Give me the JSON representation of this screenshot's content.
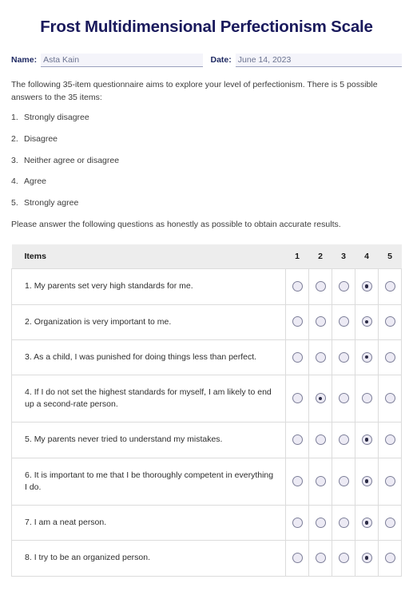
{
  "document": {
    "title": "Frost Multidimensional Perfectionism Scale"
  },
  "meta": {
    "name_label": "Name:",
    "name_value": "Asta Kain",
    "name_placeholder": "Name",
    "date_label": "Date:",
    "date_value": "June 14, 2023",
    "date_placeholder": "Date"
  },
  "intro": {
    "paragraph": "The following 35-item questionnaire aims to explore your level of perfectionism. There is 5 possible answers to the 35 items:",
    "closing": "Please answer the following questions as honestly as possible to obtain accurate results."
  },
  "options": [
    {
      "num": "1.",
      "label": "Strongly disagree"
    },
    {
      "num": "2.",
      "label": "Disagree"
    },
    {
      "num": "3.",
      "label": "Neither agree or disagree"
    },
    {
      "num": "4.",
      "label": "Agree"
    },
    {
      "num": "5.",
      "label": "Strongly agree"
    }
  ],
  "table": {
    "items_header": "Items",
    "scale_headers": [
      "1",
      "2",
      "3",
      "4",
      "5"
    ],
    "rows": [
      {
        "num": "1.",
        "text": "My parents set very high standards for me.",
        "selected": 4
      },
      {
        "num": "2.",
        "text": "Organization is very important to me.",
        "selected": 4
      },
      {
        "num": "3.",
        "text": "As a child, I was punished for doing things less than perfect.",
        "selected": 4
      },
      {
        "num": "4.",
        "text": "If I do not set the highest standards for myself, I am likely to end up a second-rate person.",
        "selected": 2
      },
      {
        "num": "5.",
        "text": "My parents never tried to understand my mistakes.",
        "selected": 4
      },
      {
        "num": "6.",
        "text": "It is important to me that I be thoroughly competent in everything I do.",
        "selected": 4
      },
      {
        "num": "7.",
        "text": "I am a neat person.",
        "selected": 4
      },
      {
        "num": "8.",
        "text": "I try to be an organized person.",
        "selected": 4
      }
    ]
  },
  "colors": {
    "title": "#1a1a5c",
    "label": "#1f2a63",
    "field_value": "#6b7390",
    "field_bg": "#f4f4fa",
    "body_text": "#3c3c3c",
    "header_bg": "#ededed",
    "border": "#dcdcdc",
    "radio_border": "#7d7f99",
    "radio_fill": "#eceaf4",
    "radio_dot": "#2b2b45"
  }
}
